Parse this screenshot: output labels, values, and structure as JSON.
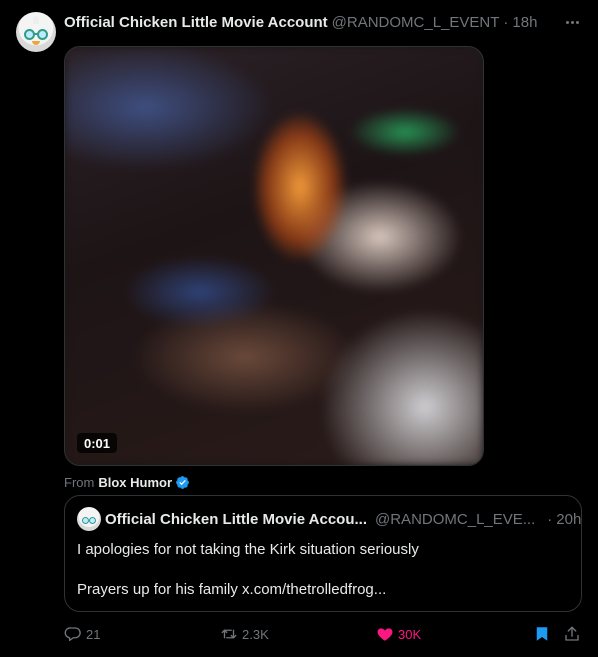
{
  "tweet": {
    "author_name": "Official Chicken Little Movie Account",
    "author_handle": "@RANDOMC_L_EVENT",
    "separator": "·",
    "time": "18h",
    "media": {
      "duration": "0:01"
    },
    "from": {
      "label": "From",
      "account": "Blox Humor"
    }
  },
  "quote": {
    "author_name": "Official Chicken Little Movie Accou...",
    "author_handle": "@RANDOMC_L_EVE...",
    "separator": "·",
    "time": "20h",
    "line1": "I apologies for not taking the Kirk situation seriously",
    "line2": "Prayers up for his family x.com/thetrolledfrog..."
  },
  "actions": {
    "reply_count": "21",
    "retweet_count": "2.3K",
    "like_count": "30K",
    "like_color": "#f91880",
    "bookmark_color": "#1d9bf0"
  },
  "colors": {
    "background": "#000000",
    "text": "#e7e9ea",
    "muted": "#71767b",
    "border": "#2f3336",
    "verified": "#1d9bf0"
  }
}
